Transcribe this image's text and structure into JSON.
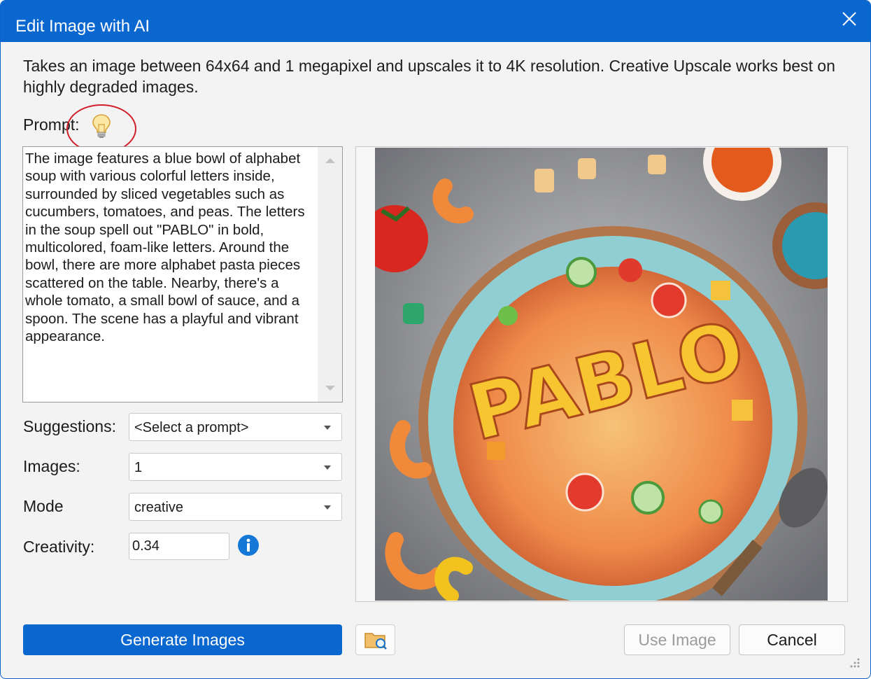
{
  "dialog": {
    "title": "Edit Image with AI",
    "description": "Takes an image between 64x64 and 1 megapixel and upscales it to 4K resolution. Creative Upscale works best on highly degraded images."
  },
  "prompt": {
    "label": "Prompt:",
    "text": "The image features a blue bowl of alphabet soup with various colorful letters inside, surrounded by sliced vegetables such as cucumbers, tomatoes, and peas. The letters in the soup spell out \"PABLO\" in bold, multicolored, foam-like letters. Around the bowl, there are more alphabet pasta pieces scattered on the table. Nearby, there's a whole tomato, a small bowl of sauce, and a spoon. The scene has a playful and vibrant appearance."
  },
  "form": {
    "suggestions_label": "Suggestions:",
    "suggestions_value": "<Select a prompt>",
    "images_label": "Images:",
    "images_value": "1",
    "mode_label": "Mode",
    "mode_value": "creative",
    "creativity_label": "Creativity:",
    "creativity_value": "0.34"
  },
  "preview": {
    "bowl_word": "PABLO"
  },
  "buttons": {
    "generate": "Generate Images",
    "use_image": "Use Image",
    "cancel": "Cancel"
  },
  "icons": {
    "close": "close-icon",
    "bulb": "lightbulb-icon",
    "info": "info-icon",
    "folder": "folder-search-icon"
  },
  "colors": {
    "accent": "#0a67d0",
    "annotation": "#d01f2b"
  }
}
